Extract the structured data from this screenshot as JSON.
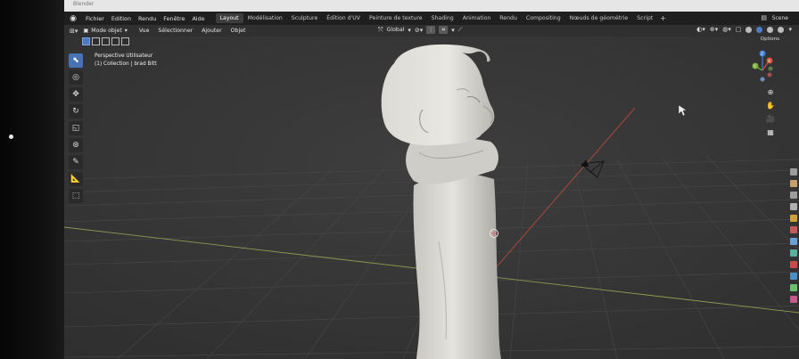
{
  "window": {
    "title": "Blender"
  },
  "menu": {
    "items": [
      "Fichier",
      "Edition",
      "Rendu",
      "Fenêtre",
      "Aide"
    ]
  },
  "workspaces": {
    "active": "Layout",
    "tabs": [
      "Layout",
      "Modélisation",
      "Sculpture",
      "Édition d'UV",
      "Peinture de texture",
      "Shading",
      "Animation",
      "Rendu",
      "Compositing",
      "Nœuds de géométrie",
      "Script"
    ],
    "add": "+"
  },
  "scene": {
    "label": "Scene"
  },
  "viewport_header": {
    "mode": "Mode objet",
    "menus": [
      "Vue",
      "Sélectionner",
      "Ajouter",
      "Objet"
    ],
    "orientation": "Global",
    "options": "Options"
  },
  "overlay": {
    "view_name": "Perspective Utilisateur",
    "collection": "(1) Collection | brad Bitt"
  },
  "gizmo": {
    "x": "X",
    "y": "Y",
    "z": "Z"
  },
  "colors": {
    "accent": "#4772b3",
    "x_axis": "#d8503f",
    "y_axis": "#7fb040",
    "z_axis": "#3f7fd8"
  }
}
